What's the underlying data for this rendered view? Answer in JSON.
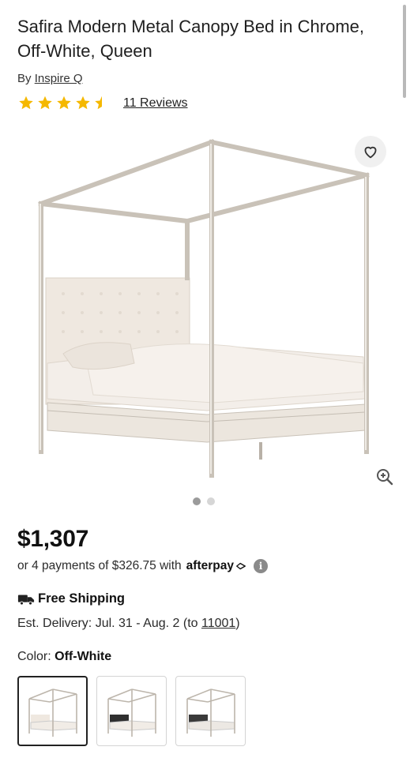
{
  "product": {
    "title": "Safira Modern Metal Canopy Bed in Chrome, Off-White, Queen",
    "brand_prefix": "By",
    "brand": "Inspire Q",
    "rating": 4.5,
    "reviews_label": "11 Reviews"
  },
  "gallery": {
    "total_images": 2,
    "active_index": 0,
    "favorite_icon": "heart-icon",
    "zoom_icon": "zoom-in-icon"
  },
  "pricing": {
    "price": "$1,307",
    "installments_text": "or 4 payments of $326.75 with",
    "afterpay_label": "afterpay",
    "info_icon": "info-icon"
  },
  "shipping": {
    "label": "Free Shipping",
    "delivery_prefix": "Est. Delivery: Jul. 31 - Aug. 2 (to ",
    "zip": "11001",
    "delivery_suffix": ")"
  },
  "color": {
    "label": "Color:",
    "selected": "Off-White",
    "options": [
      "Off-White",
      "Black",
      "Dark Grey"
    ]
  },
  "colors": {
    "star": "#f5b800",
    "frame": "#cfc9c0",
    "upholstery": "#efe9e2"
  }
}
